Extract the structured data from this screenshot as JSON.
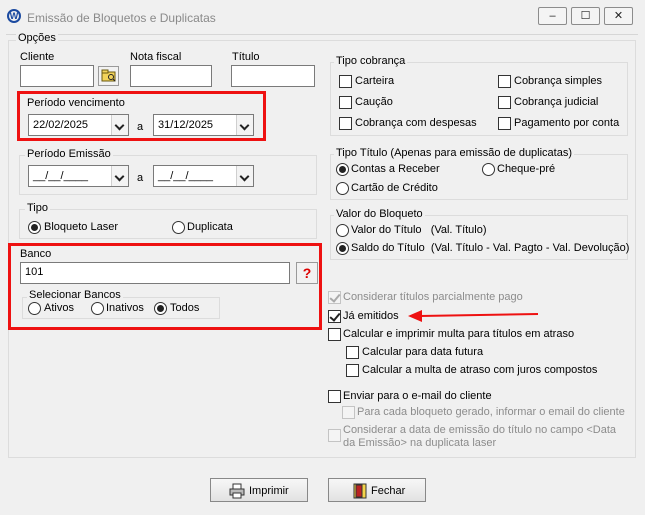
{
  "window": {
    "title": "Emissão de Bloquetos e Duplicatas",
    "minimize": "–",
    "maximize": "☐",
    "close": "✕"
  },
  "opcoes": {
    "label": "Opções"
  },
  "cliente": {
    "label": "Cliente",
    "value": ""
  },
  "nota_fiscal": {
    "label": "Nota fiscal",
    "value": ""
  },
  "titulo": {
    "label": "Título",
    "value": ""
  },
  "periodo_vencimento": {
    "label": "Período vencimento",
    "from": "22/02/2025",
    "sep": "a",
    "to": "31/12/2025"
  },
  "periodo_emissao": {
    "label": "Período Emissão",
    "from": "__/__/____",
    "sep": "a",
    "to": "__/__/____"
  },
  "tipo": {
    "label": "Tipo",
    "options": [
      "Bloqueto Laser",
      "Duplicata"
    ],
    "selected": "Bloqueto Laser"
  },
  "banco": {
    "label": "Banco",
    "value": "101",
    "lookup_glyph": "?"
  },
  "selecionar_bancos": {
    "label": "Selecionar Bancos",
    "options": [
      "Ativos",
      "Inativos",
      "Todos"
    ],
    "selected": "Todos"
  },
  "tipo_cobranca": {
    "label": "Tipo cobrança",
    "options": [
      "Carteira",
      "Cobrança simples",
      "Caução",
      "Cobrança judicial",
      "Cobrança com despesas",
      "Pagamento por conta"
    ],
    "checked": []
  },
  "tipo_titulo": {
    "label": "Tipo Título (Apenas para emissão de duplicatas)",
    "options": [
      "Contas a Receber",
      "Cheque-pré",
      "Cartão de Crédito"
    ],
    "selected": "Contas a Receber"
  },
  "valor_bloqueto": {
    "label": "Valor do Bloqueto",
    "options": [
      "Valor do Título   (Val. Título)",
      "Saldo do Título  (Val. Título - Val. Pagto - Val. Devolução)"
    ],
    "selected": "Saldo do Título  (Val. Título - Val. Pagto - Val. Devolução)"
  },
  "checks": {
    "considerar_parcial": {
      "label": "Considerar títulos parcialmente pago",
      "checked": true,
      "enabled": false
    },
    "ja_emitidos": {
      "label": "Já emitidos",
      "checked": true,
      "enabled": true
    },
    "calcular_multa": {
      "label": "Calcular e imprimir multa para títulos em atraso",
      "checked": false,
      "enabled": true
    },
    "data_futura": {
      "label": "Calcular para data futura",
      "checked": false,
      "enabled": true
    },
    "juros_compostos": {
      "label": "Calcular a multa de atraso com juros compostos",
      "checked": false,
      "enabled": true
    },
    "enviar_email": {
      "label": "Enviar para o e-mail do cliente",
      "checked": false,
      "enabled": true
    },
    "cada_bloqueto": {
      "label": "Para cada bloqueto gerado, informar o email do cliente",
      "checked": false,
      "enabled": false
    },
    "data_emissao_line1": {
      "label": "Considerar a data de emissão do título no campo <Data",
      "checked": false,
      "enabled": false
    },
    "data_emissao_line2": {
      "label": "da Emissão> na duplicata laser"
    }
  },
  "buttons": {
    "imprimir": "Imprimir",
    "fechar": "Fechar"
  },
  "colors": {
    "highlight": "#e11111",
    "arrow": "#e11111"
  }
}
